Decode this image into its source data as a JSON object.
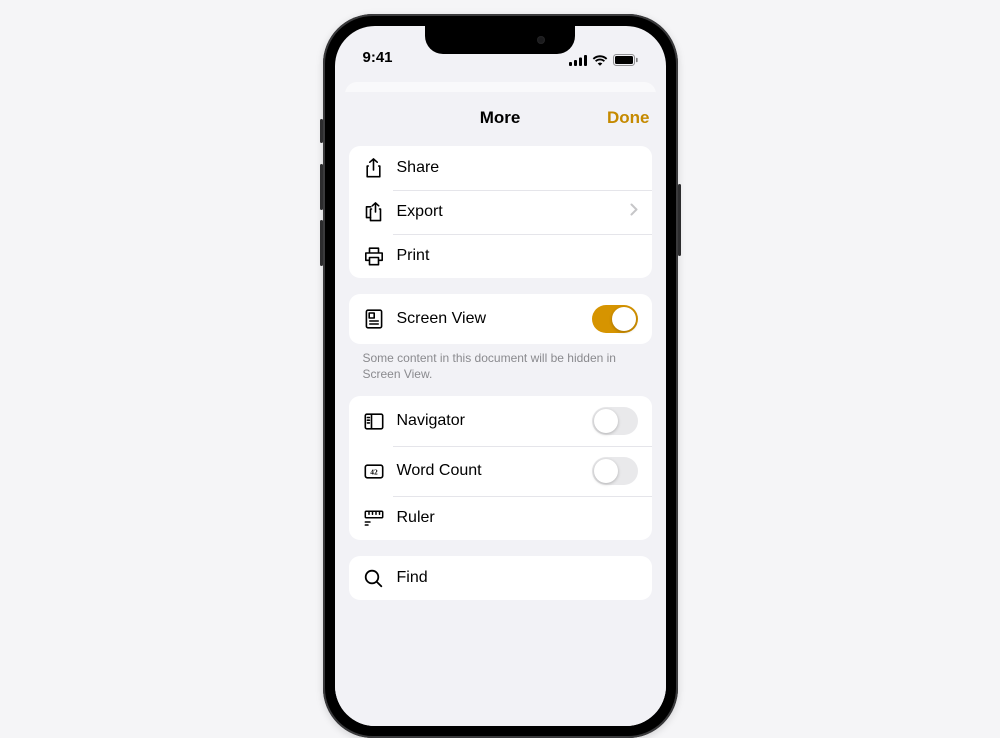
{
  "statusBar": {
    "time": "9:41"
  },
  "sheet": {
    "title": "More",
    "done": "Done",
    "group1": {
      "share": {
        "label": "Share"
      },
      "export": {
        "label": "Export"
      },
      "print": {
        "label": "Print"
      }
    },
    "group2": {
      "screenView": {
        "label": "Screen View",
        "on": true
      },
      "footer": "Some content in this document will be hidden in Screen View."
    },
    "group3": {
      "navigator": {
        "label": "Navigator",
        "on": false
      },
      "wordCount": {
        "label": "Word Count",
        "on": false
      },
      "ruler": {
        "label": "Ruler"
      }
    },
    "group4": {
      "find": {
        "label": "Find"
      }
    }
  }
}
